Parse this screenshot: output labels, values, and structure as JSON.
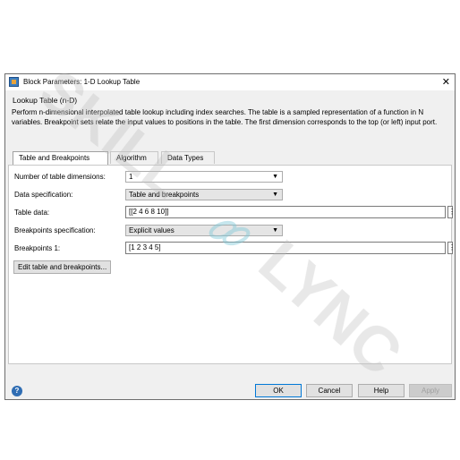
{
  "window": {
    "title": "Block Parameters: 1-D Lookup Table",
    "close_glyph": "✕"
  },
  "block": {
    "type": "Lookup Table (n-D)",
    "description": "Perform n-dimensional interpolated table lookup including index searches. The table is a sampled representation of a function in N variables. Breakpoint sets relate the input values to positions in the table. The first dimension corresponds to the top (or left) input port."
  },
  "tabs": [
    {
      "label": "Table and Breakpoints",
      "active": true
    },
    {
      "label": "Algorithm",
      "active": false
    },
    {
      "label": "Data Types",
      "active": false
    }
  ],
  "params": {
    "num_dims": {
      "label": "Number of table dimensions:",
      "value": "1"
    },
    "data_spec": {
      "label": "Data specification:",
      "value": "Table and breakpoints"
    },
    "table_data": {
      "label": "Table data:",
      "value": "[[2 4 6 8 10]]"
    },
    "bp_spec": {
      "label": "Breakpoints specification:",
      "value": "Explicit values"
    },
    "bp1": {
      "label": "Breakpoints 1:",
      "value": "[1 2 3 4 5]"
    }
  },
  "edit_button_label": "Edit table and breakpoints...",
  "more_glyph": "⋮",
  "buttons": {
    "ok": "OK",
    "cancel": "Cancel",
    "help": "Help",
    "apply": "Apply"
  },
  "watermark_text": "SKILL-LYNC",
  "icons": {
    "app": "simulink-block-icon",
    "help": "help-circle-icon",
    "dropdown": "chevron-down-icon"
  },
  "colors": {
    "dialog_bg": "#f0f0f0",
    "accent": "#0078d7",
    "watermark": "#bfbfbf"
  }
}
